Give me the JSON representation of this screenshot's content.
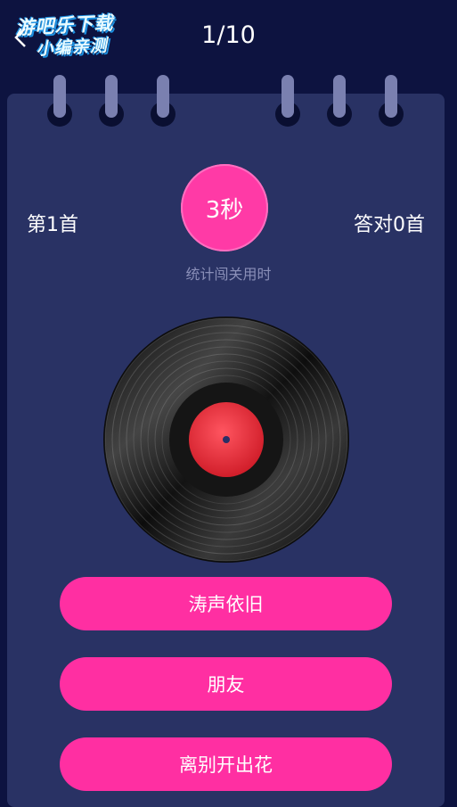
{
  "watermark": {
    "line1": "游吧乐下载",
    "line2": "小编亲测"
  },
  "header": {
    "progress": "1/10"
  },
  "quiz": {
    "song_number_label": "第1首",
    "correct_count_label": "答对0首",
    "timer_label": "3秒",
    "timer_caption": "统计闯关用时"
  },
  "answers": [
    "涛声依旧",
    "朋友",
    "离别开出花"
  ],
  "colors": {
    "background": "#0d1340",
    "card": "#293264",
    "accent_pink": "#ff2fa2",
    "record_label": "#e0303a"
  },
  "icons": {
    "back": "chevron-left-icon",
    "record": "vinyl-record-icon"
  }
}
